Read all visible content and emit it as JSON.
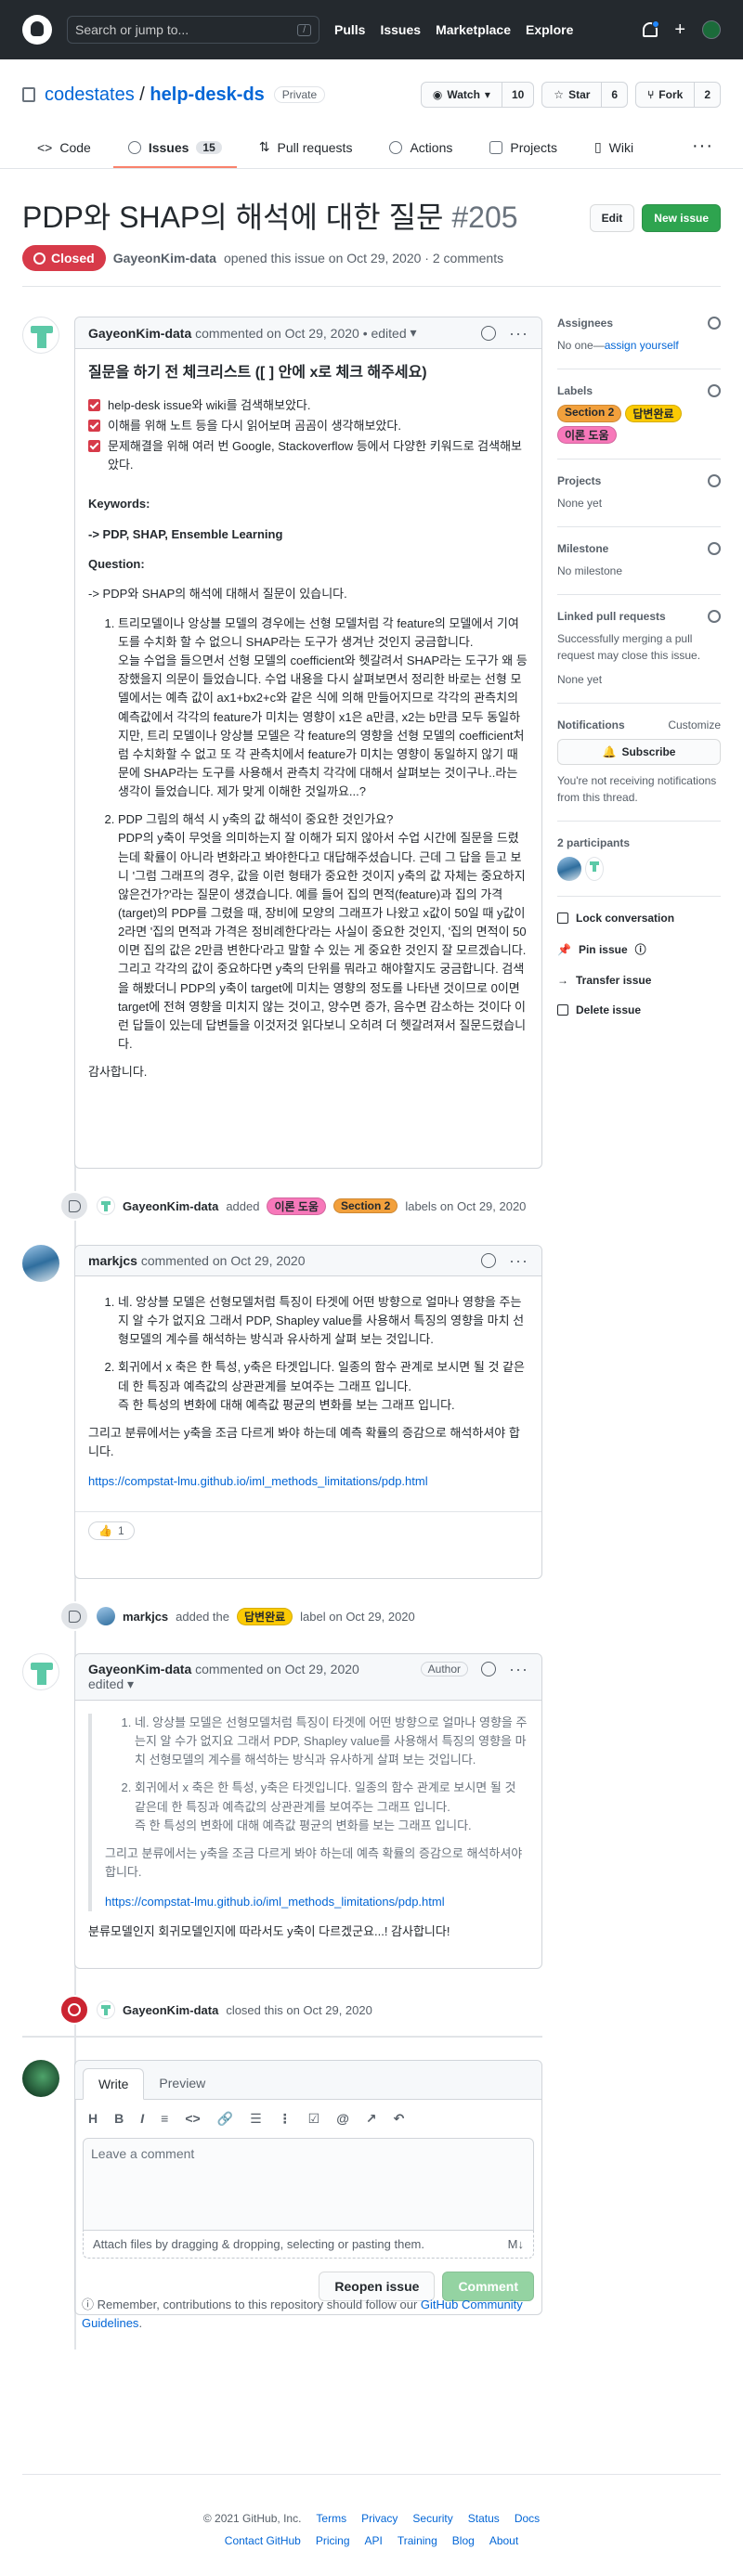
{
  "header": {
    "search_placeholder": "Search or jump to...",
    "search_key": "/",
    "nav": [
      "Pulls",
      "Issues",
      "Marketplace",
      "Explore"
    ],
    "plus": "+"
  },
  "repo": {
    "owner": "codestates",
    "sep": "/",
    "name": "help-desk-ds",
    "visibility": "Private",
    "watch": {
      "label": "Watch",
      "count": "10"
    },
    "star": {
      "label": "Star",
      "count": "6"
    },
    "fork": {
      "label": "Fork",
      "count": "2"
    },
    "tabs": [
      {
        "label": "Code"
      },
      {
        "label": "Issues",
        "count": "15"
      },
      {
        "label": "Pull requests"
      },
      {
        "label": "Actions"
      },
      {
        "label": "Projects"
      },
      {
        "label": "Wiki"
      }
    ],
    "more": "···"
  },
  "issue": {
    "title": "PDP와 SHAP의 해석에 대한 질문",
    "number": "#205",
    "edit": "Edit",
    "new_issue": "New issue",
    "state": "Closed",
    "author": "GayeonKim-data",
    "meta": "opened this issue on Oct 29, 2020 · 2 comments"
  },
  "c1": {
    "author": "GayeonKim-data",
    "meta": "commented on Oct 29, 2020 • edited",
    "heading": "질문을 하기 전 체크리스트 ([ ] 안에 x로 체크 해주세요)",
    "checks": [
      "help-desk issue와 wiki를 검색해보았다.",
      "이해를 위해 노트 등을 다시 읽어보며 곰곰이 생각해보았다.",
      "문제해결을 위해 여러 번 Google, Stackoverflow 등에서 다양한 키워드로 검색해보았다."
    ],
    "kw_label": "Keywords:",
    "kw": "-> PDP, SHAP, Ensemble Learning",
    "q_label": "Question:",
    "q_intro": "-> PDP와 SHAP의 해석에 대해서 질문이 있습니다.",
    "items": [
      "트리모델이나 앙상블 모델의 경우에는 선형 모델처럼 각 feature의 모델에서 기여도를 수치화 할 수 없으니 SHAP라는 도구가 생겨난 것인지 궁금합니다.\n오늘 수업을 들으면서 선형 모델의 coefficient와 헷갈려서 SHAP라는 도구가 왜 등장했을지 의문이 들었습니다. 수업 내용을 다시 살펴보면서 정리한 바로는 선형 모델에서는 예측 값이 ax1+bx2+c와 같은 식에 의해 만들어지므로 각각의 관측치의 예측값에서 각각의 feature가 미치는 영향이 x1은 a만큼, x2는 b만큼 모두 동일하지만, 트리 모델이나 앙상블 모델은 각 feature의 영향을 선형 모델의 coefficient처럼 수치화할 수 없고 또 각 관측치에서 feature가 미치는 영향이 동일하지 않기 때문에 SHAP라는 도구를 사용해서 관측치 각각에 대해서 살펴보는 것이구나..라는 생각이 들었습니다. 제가 맞게 이해한 것일까요...?",
      "PDP 그림의 해석 시 y축의 값 해석이 중요한 것인가요?\nPDP의 y축이 무엇을 의미하는지 잘 이해가 되지 않아서 수업 시간에 질문을 드렸는데 확률이 아니라 변화라고 봐야한다고 대답해주셨습니다. 근데 그 답을 듣고 보니 '그럼 그래프의 경우, 값을 이런 형태가 중요한 것이지 y축의 값 자체는 중요하지 않은건가?'라는 질문이 생겼습니다. 예를 들어 집의 면적(feature)과 집의 가격(target)의 PDP를 그렸을 때, 장비에 모양의 그래프가 나왔고 x값이 50일 때 y값이 2라면 '집의 면적과 가격은 정비례한다'라는 사실이 중요한 것인지, '집의 면적이 50이면 집의 값은 2만큼 변한다'라고 말할 수 있는 게 중요한 것인지 잘 모르겠습니다. 그리고 각각의 값이 중요하다면 y축의 단위를 뭐라고 해야할지도 궁금합니다. 검색을 해봤더니 PDP의 y축이 target에 미치는 영향의 정도를 나타낸 것이므로 0이면 target에 전혀 영향을 미치지 않는 것이고, 양수면 증가, 음수면 감소하는 것이다 이런 답들이 있는데 답변들을 이것저것 읽다보니 오히려 더 헷갈려져서 질문드렸습니다."
    ],
    "thanks": "감사합니다."
  },
  "ev1": {
    "actor": "GayeonKim-data",
    "verb": "added",
    "labels": [
      "이론 도움",
      "Section 2"
    ],
    "tail": "labels on Oct 29, 2020"
  },
  "c2": {
    "author": "markjcs",
    "meta": "commented on Oct 29, 2020",
    "items": [
      "네. 앙상블 모델은 선형모델처럼 특징이 타겟에 어떤 방향으로 얼마나 영향을 주는지 알 수가 없지요 그래서 PDP, Shapley value를 사용해서 특징의 영향을 마치 선형모델의 계수를 해석하는 방식과 유사하게 살펴 보는 것입니다.",
      "회귀에서 x 축은 한 특성, y축은 타겟입니다. 일종의 함수 관계로 보시면 될 것 같은데 한 특징과 예측값의 상관관계를 보여주는 그래프 입니다.\n즉 한 특성의 변화에 대해 예측값 평균의 변화를 보는 그래프 입니다."
    ],
    "para": "그리고 분류에서는 y축을 조금 다르게 봐야 하는데 예측 확률의 증감으로 해석하셔야 합니다.",
    "link": "https://compstat-lmu.github.io/iml_methods_limitations/pdp.html",
    "reaction": {
      "emoji": "👍",
      "count": "1"
    }
  },
  "ev2": {
    "actor": "markjcs",
    "verb": "added the",
    "label": "답변완료",
    "tail": "label on Oct 29, 2020"
  },
  "c3": {
    "author": "GayeonKim-data",
    "meta": "commented on Oct 29, 2020",
    "meta2": "edited",
    "badge": "Author",
    "quote_items": [
      "네. 앙상블 모델은 선형모델처럼 특징이 타겟에 어떤 방향으로 얼마나 영향을 주는지 알 수가 없지요 그래서 PDP, Shapley value를 사용해서 특징의 영향을 마치 선형모델의 계수를 해석하는 방식과 유사하게 살펴 보는 것입니다.",
      "회귀에서 x 축은 한 특성, y축은 타겟입니다. 일종의 함수 관계로 보시면 될 것 같은데 한 특징과 예측값의 상관관계를 보여주는 그래프 입니다.\n즉 한 특성의 변화에 대해 예측값 평균의 변화를 보는 그래프 입니다."
    ],
    "quote_para": "그리고 분류에서는 y축을 조금 다르게 봐야 하는데 예측 확률의 증감으로 해석하셔야 합니다.",
    "quote_link": "https://compstat-lmu.github.io/iml_methods_limitations/pdp.html",
    "reply": "분류모델인지 회귀모델인지에 따라서도 y축이 다르겠군요...! 감사합니다!"
  },
  "ev3": {
    "actor": "GayeonKim-data",
    "tail": "closed this on Oct 29, 2020"
  },
  "newcomment": {
    "tabs": [
      "Write",
      "Preview"
    ],
    "toolbar": [
      "H",
      "B",
      "I",
      "≡",
      "<>",
      "🔗",
      "☰",
      "⋮",
      "☑",
      "@",
      "↗",
      "↶"
    ],
    "placeholder": "Leave a comment",
    "attach": "Attach files by dragging & dropping, selecting or pasting them.",
    "md": "M↓",
    "reopen": "Reopen issue",
    "comment": "Comment"
  },
  "remember": {
    "text": "Remember, contributions to this repository should follow our ",
    "link": "GitHub Community Guidelines",
    "end": "."
  },
  "sidebar": {
    "assignees": {
      "title": "Assignees",
      "text": "No one—",
      "link": "assign yourself"
    },
    "labels": {
      "title": "Labels",
      "items": [
        {
          "name": "Section 2",
          "color": "#f2a03c"
        },
        {
          "name": "답변완료",
          "color": "#fbca04"
        },
        {
          "name": "이론 도움",
          "color": "#f778ba"
        }
      ]
    },
    "projects": {
      "title": "Projects",
      "text": "None yet"
    },
    "milestone": {
      "title": "Milestone",
      "text": "No milestone"
    },
    "linked": {
      "title": "Linked pull requests",
      "text": "Successfully merging a pull request may close this issue.",
      "none": "None yet"
    },
    "notifications": {
      "title": "Notifications",
      "customize": "Customize",
      "button": "Subscribe",
      "text": "You're not receiving notifications from this thread."
    },
    "participants": {
      "title": "2 participants"
    },
    "actions": [
      "Lock conversation",
      "Pin issue",
      "Transfer issue",
      "Delete issue"
    ]
  },
  "footer": {
    "copy": "© 2021 GitHub, Inc.",
    "row1": [
      "Terms",
      "Privacy",
      "Security",
      "Status",
      "Docs"
    ],
    "row2": [
      "Contact GitHub",
      "Pricing",
      "API",
      "Training",
      "Blog",
      "About"
    ]
  }
}
